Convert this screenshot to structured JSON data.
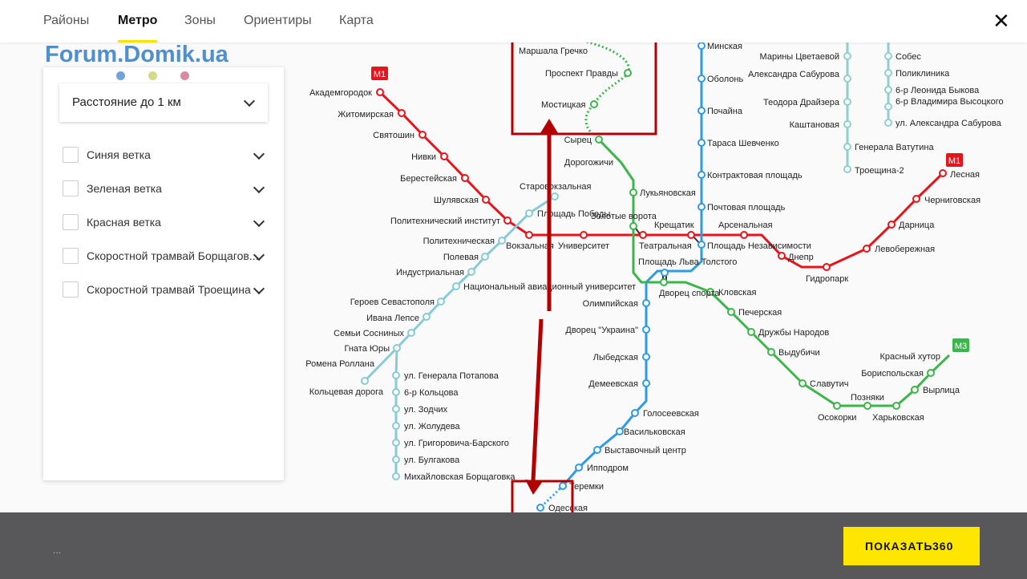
{
  "tabs": [
    {
      "label": "Районы",
      "active": false
    },
    {
      "label": "Метро",
      "active": true
    },
    {
      "label": "Зоны",
      "active": false
    },
    {
      "label": "Ориентиры",
      "active": false
    },
    {
      "label": "Карта",
      "active": false
    }
  ],
  "close_icon": "close-icon",
  "watermark": "Forum.Domik.ua",
  "filter": {
    "distance_label": "Расстояние до 1 км",
    "lines": [
      {
        "label": "Синяя ветка",
        "checked": false
      },
      {
        "label": "Зеленая ветка",
        "checked": false
      },
      {
        "label": "Красная ветка",
        "checked": false
      },
      {
        "label": "Скоростной трамвай Борщагов...",
        "checked": false
      },
      {
        "label": "Скоростной трамвай Троещина",
        "checked": false
      }
    ]
  },
  "map": {
    "colors": {
      "red": "#e8141b",
      "blue": "#2f9be0",
      "green": "#3cb54a",
      "lightblue": "#88cbd6",
      "tram": "#8fd0cf",
      "highlight": "#b30000"
    },
    "badges": {
      "m1_west": "M1",
      "m1_east": "M1",
      "m3": "M3"
    },
    "red_line": [
      "Академгородок",
      "Житомирская",
      "Святошин",
      "Нивки",
      "Берестейская",
      "Шулявская",
      "Политехнический институт",
      "Вокзальная",
      "Университет",
      "Театральная",
      "Крещатик",
      "Арсенальная",
      "Днепр",
      "Гидропарк",
      "Левобережная",
      "Дарница",
      "Черниговская",
      "Лесная"
    ],
    "blue_line": [
      "Минская",
      "Оболонь",
      "Почайна",
      "Тараса Шевченко",
      "Контрактовая площадь",
      "Почтовая площадь",
      "Площадь Независимости",
      "Площадь Льва Толстого",
      "Олимпийская",
      "Дворец \"Украина\"",
      "Лыбедская",
      "Демеевская",
      "Голосеевская",
      "Васильковская",
      "Выставочный центр",
      "Ипподром",
      "Теремки",
      "Одесская"
    ],
    "green_line": [
      "Маршала Гречко",
      "Проспект Правды",
      "Мостицкая",
      "Сырец",
      "Дорогожичи",
      "Лукьяновская",
      "Золотые ворота",
      "Дворец спорта",
      "Кловская",
      "Печерская",
      "Дружбы Народов",
      "Выдубичи",
      "Славутич",
      "Осокорки",
      "Позняки",
      "Харьковская",
      "Вырлица",
      "Бориспольская",
      "Красный хутор"
    ],
    "tram_borsch": [
      "Старовокзальная",
      "Площадь Победы",
      "Политехническая",
      "Полевая",
      "Индустриальная",
      "Национальный авиационный университет",
      "Героев Севастополя",
      "Ивана Лепсе",
      "Семьи Сосниных",
      "Гната Юры",
      "Ромена Роллана",
      "Кольцевая дорога",
      "ул. Генерала Потапова",
      "6-р Кольцова",
      "ул. Зодчих",
      "ул. Жолудева",
      "ул. Григоровича-Барского",
      "ул. Булгакова",
      "Михайловская Борщаговка"
    ],
    "tram_troesh": [
      "Марины Цветаевой",
      "Александра Сабурова",
      "Теодора Драйзера",
      "Каштановая",
      "Генерала Ватутина",
      "Троещина-2",
      "Собес",
      "Поликлиника",
      "6-р Леонида Быкова",
      "6-р Владимира Высоцкого",
      "ул. Александра Сабурова"
    ]
  },
  "bottom": {
    "status": "...",
    "show_label": "ПОКАЗАТЬ",
    "count": "360"
  }
}
